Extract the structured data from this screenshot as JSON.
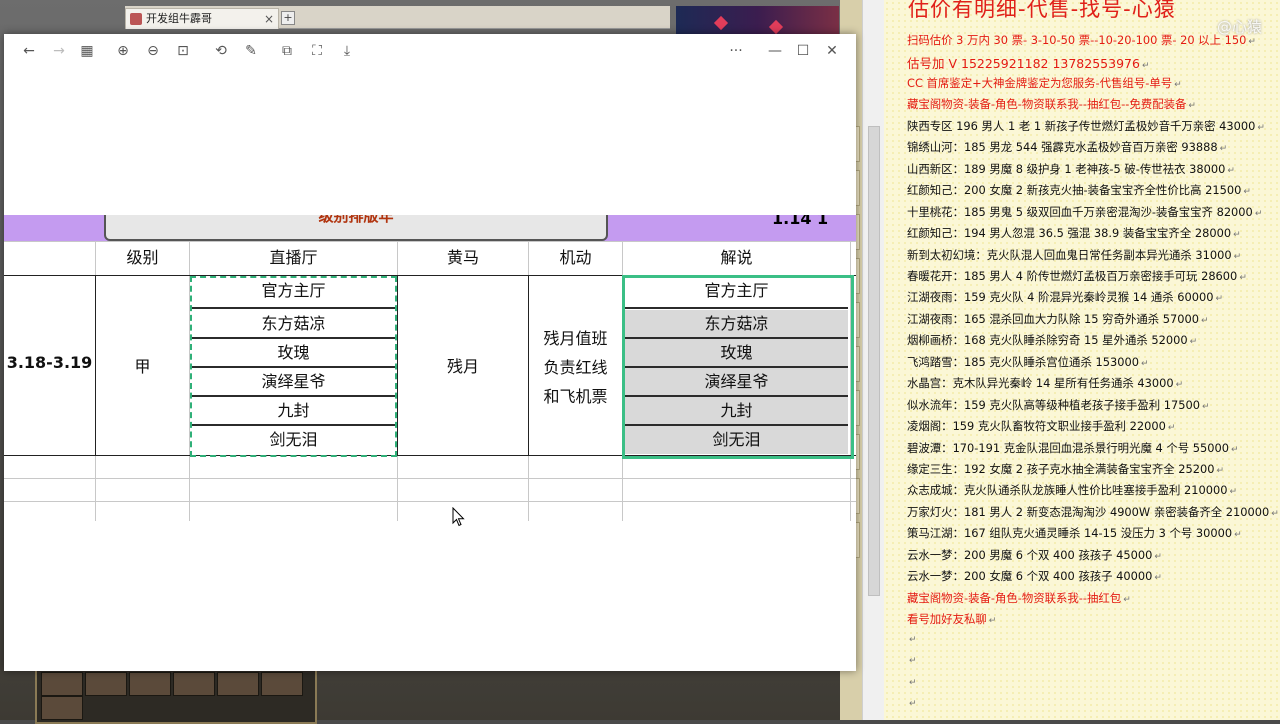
{
  "background": {
    "tab_title": "开发组牛霹哥",
    "tab_close": "×",
    "tab_add": "+"
  },
  "viewer": {
    "toolbar": {
      "back": "←",
      "forward": "→",
      "grid": "▦",
      "zoom_in": "⊕",
      "zoom_out": "⊖",
      "fit": "⊡",
      "rotate": "⟲",
      "edit": "✎",
      "copy": "⧉",
      "crop": "⛶",
      "save": "⤓",
      "more": "···",
      "minimize": "—",
      "maximize": "☐",
      "close": "✕"
    },
    "sheet": {
      "title": "级别排版年",
      "corner": "1.14 1",
      "headers": [
        "级别",
        "直播厅",
        "黄马",
        "机动",
        "解说"
      ],
      "date": "3.18-3.19",
      "level": "甲",
      "huangma": "残月",
      "jidong": [
        "残月值班",
        "负责红线",
        "和飞机票"
      ],
      "zhibo": [
        "官方主厅",
        "东方菇凉",
        "玫瑰",
        "演绎星爷",
        "九封",
        "剑无泪"
      ],
      "jieshuo": [
        "官方主厅",
        "东方菇凉",
        "玫瑰",
        "演绎星爷",
        "九封",
        "剑无泪"
      ]
    }
  },
  "panel": {
    "title": "估价有明细-代售-找号-心猿",
    "watermark": "@心猿",
    "lines": [
      {
        "text": "扫码估价 3 万内 30 票- 3-10-50 票--10-20-100 票- 20 以上 150",
        "style": "red"
      },
      {
        "text": "估号加 V 15225921182    13782553976",
        "style": "redbig"
      },
      {
        "text": "CC 首席鉴定+大神金牌鉴定为您服务-代售组号-单号",
        "style": "red"
      },
      {
        "text": "藏宝阁物资-装备-角色-物资联系我--抽红包--免费配装备",
        "style": "red"
      },
      {
        "text": "陕西专区 196 男人 1 老 1 新孩子传世燃灯孟极妙音千万亲密 43000",
        "style": ""
      },
      {
        "text": "锦绣山河：185 男龙 544 强霹克水孟极妙音百万亲密 93888",
        "style": ""
      },
      {
        "text": "山西新区：189 男魔 8 级护身 1 老神孩-5 破-传世祛衣 38000",
        "style": ""
      },
      {
        "text": "红颜知己：200 女魔 2 新孩克火抽-装备宝宝齐全性价比高 21500",
        "style": ""
      },
      {
        "text": "十里桃花：185 男鬼 5 级双回血千万亲密混淘沙-装备宝宝齐 82000",
        "style": ""
      },
      {
        "text": "红颜知己：194 男人忽混 36.5 强混 38.9 装备宝宝齐全 28000",
        "style": ""
      },
      {
        "text": "新到太初幻境：克火队混人回血鬼日常任务副本异光通杀 31000",
        "style": ""
      },
      {
        "text": "春暖花开：185 男人 4 阶传世燃灯孟极百万亲密接手可玩 28600",
        "style": ""
      },
      {
        "text": "江湖夜雨：159 克火队 4 阶混异光秦岭灵猴 14 通杀 60000",
        "style": ""
      },
      {
        "text": "江湖夜雨：165 混杀回血大力队除 15 穷奇外通杀 57000",
        "style": ""
      },
      {
        "text": "烟柳画桥：168 克火队睡杀除穷奇 15 星外通杀 52000",
        "style": ""
      },
      {
        "text": "飞鸿踏雪：185 克火队睡杀宫位通杀 153000",
        "style": ""
      },
      {
        "text": "水晶宫：克木队异光秦岭 14 星所有任务通杀 43000",
        "style": ""
      },
      {
        "text": "似水流年：159 克火队高等级种植老孩子接手盈利 17500",
        "style": ""
      },
      {
        "text": "凌烟阁：159 克火队畜牧符文职业接手盈利 22000",
        "style": ""
      },
      {
        "text": "碧波潭：170-191 克金队混回血混杀景行明光魔 4 个号 55000",
        "style": ""
      },
      {
        "text": "缘定三生：192 女魔 2 孩子克水抽全满装备宝宝齐全 25200",
        "style": ""
      },
      {
        "text": "众志成城：克火队通杀队龙族睡人性价比哇塞接手盈利 210000",
        "style": ""
      },
      {
        "text": "万家灯火：181 男人 2 新变态混淘淘沙 4900W 亲密装备齐全 210000",
        "style": ""
      },
      {
        "text": "策马江湖：167 组队克火通灵睡杀 14-15 没压力 3 个号 30000",
        "style": ""
      },
      {
        "text": "云水一梦：200 男魔 6 个双 400 孩孩子 45000",
        "style": ""
      },
      {
        "text": "云水一梦：200 女魔 6 个双 400 孩孩子 40000",
        "style": ""
      },
      {
        "text": "藏宝阁物资-装备-角色-物资联系我--抽红包",
        "style": "red"
      },
      {
        "text": "看号加好友私聊",
        "style": "red"
      }
    ],
    "crlf": "↵"
  }
}
